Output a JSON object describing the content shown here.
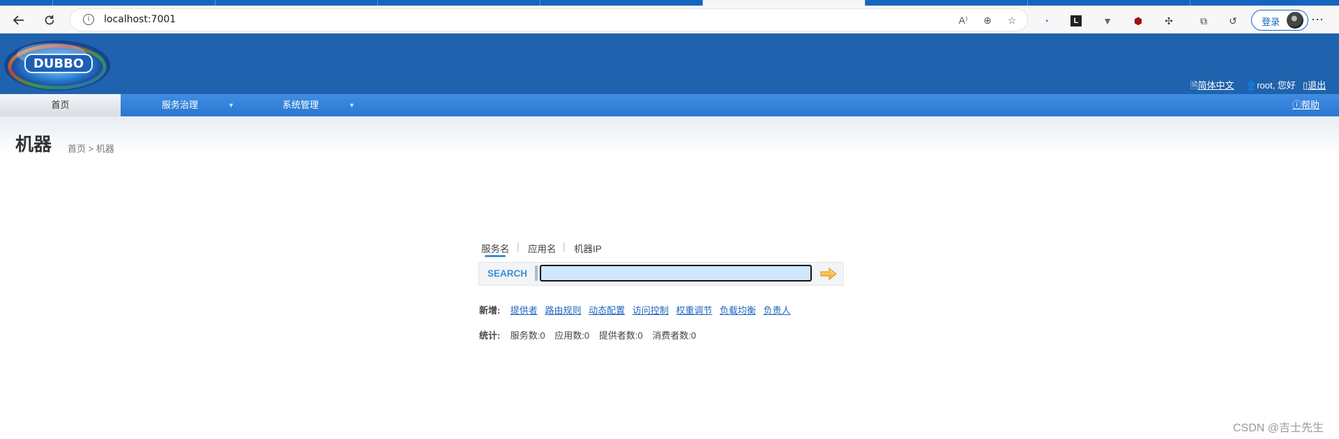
{
  "browser": {
    "url": "localhost:7001",
    "login_label": "登录"
  },
  "header": {
    "logo_text": "DUBBO",
    "lang_label": "简体中文",
    "user_greeting": "root, 您好",
    "logout_label": "退出"
  },
  "menu": {
    "home": "首页",
    "service_governance": "服务治理",
    "system_management": "系统管理",
    "help": "帮助"
  },
  "page": {
    "title": "机器",
    "breadcrumb": "首页 > 机器"
  },
  "search": {
    "tabs": [
      "服务名",
      "应用名",
      "机器IP"
    ],
    "separator": "|",
    "label": "SEARCH",
    "value": ""
  },
  "add": {
    "label": "新增:",
    "links": [
      "提供者",
      "路由规则",
      "动态配置",
      "访问控制",
      "权重调节",
      "负载均衡",
      "负责人"
    ]
  },
  "stats": {
    "label": "统计:",
    "items": [
      "服务数:0",
      "应用数:0",
      "提供者数:0",
      "消费者数:0"
    ]
  },
  "watermark": "CSDN @吉士先生",
  "colors": {
    "header_blue": "#1f62ad",
    "menu_blue": "#2a77cf",
    "link_blue": "#1d66bf",
    "search_label_blue": "#3c8fd6"
  }
}
